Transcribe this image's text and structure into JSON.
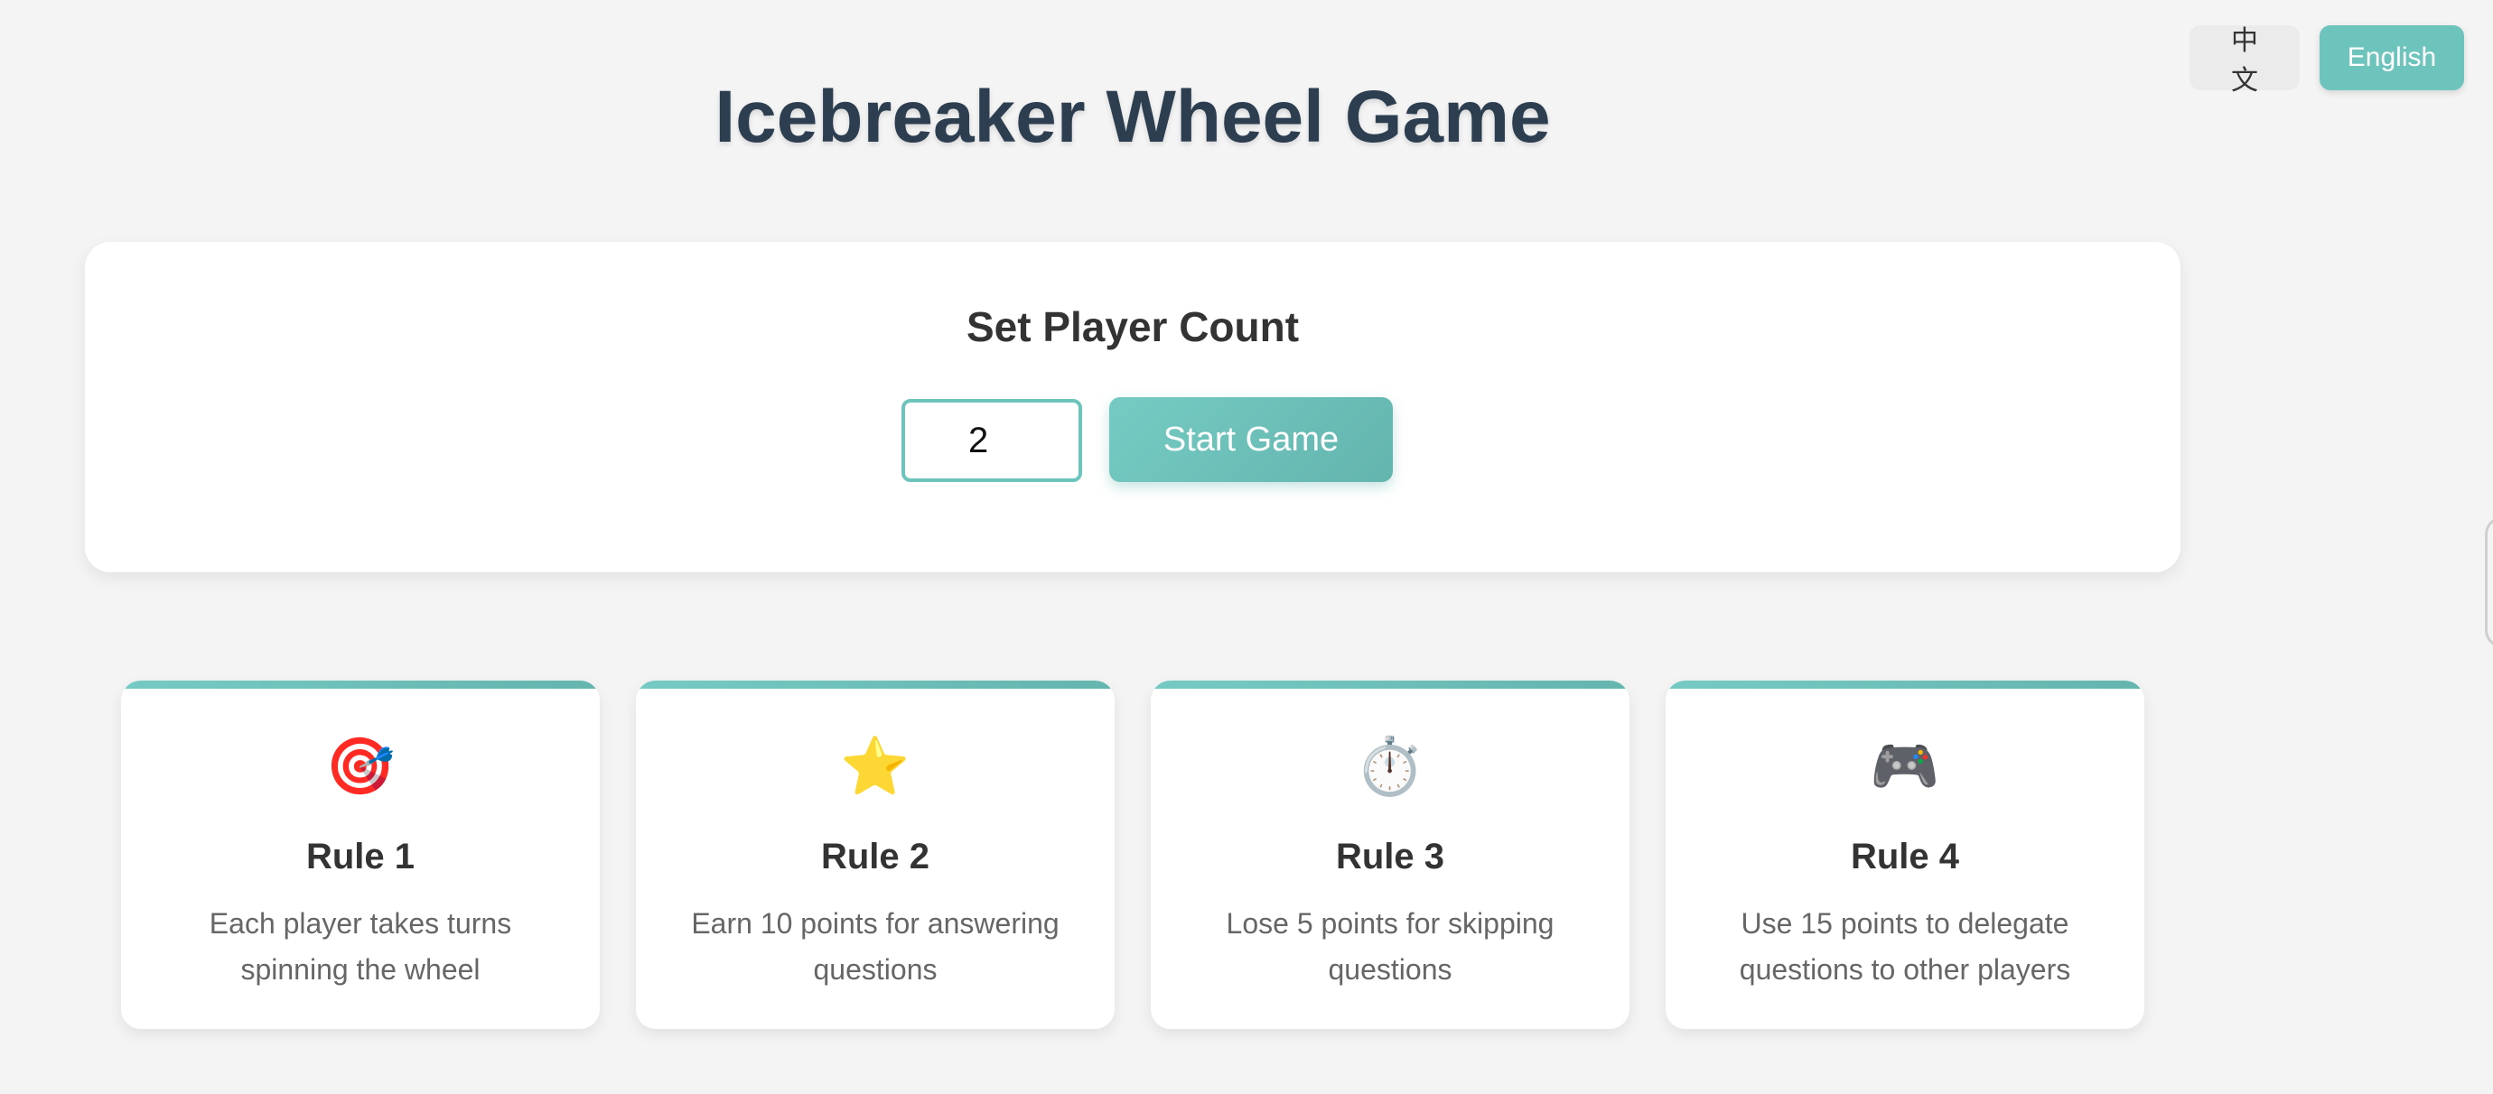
{
  "header": {
    "title": "Icebreaker Wheel Game"
  },
  "language": {
    "chinese_label": "中文",
    "english_label": "English",
    "active": "English"
  },
  "setup": {
    "title": "Set Player Count",
    "player_count": "2",
    "start_label": "Start Game"
  },
  "rules": [
    {
      "icon": "🎯",
      "icon_name": "target-icon",
      "title": "Rule 1",
      "description": "Each player takes turns spinning the wheel"
    },
    {
      "icon": "⭐",
      "icon_name": "star-icon",
      "title": "Rule 2",
      "description": "Earn 10 points for answering questions"
    },
    {
      "icon": "⏱️",
      "icon_name": "stopwatch-icon",
      "title": "Rule 3",
      "description": "Lose 5 points for skipping questions"
    },
    {
      "icon": "🎮",
      "icon_name": "gamepad-icon",
      "title": "Rule 4",
      "description": "Use 15 points to delegate questions to other players"
    }
  ],
  "colors": {
    "accent": "#6cc4bd",
    "title": "#2c3e50",
    "background": "#f4f4f4"
  }
}
